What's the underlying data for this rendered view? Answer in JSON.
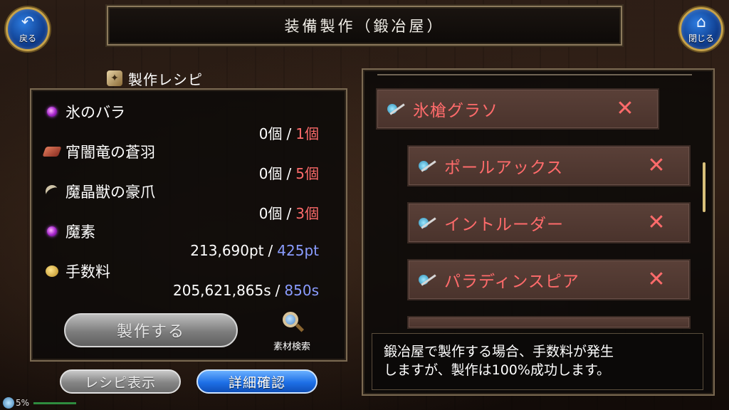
{
  "header": {
    "title": "装備製作（鍛冶屋）",
    "back_label": "戻る",
    "close_label": "閉じる"
  },
  "recipe": {
    "title": "製作レシピ",
    "materials": [
      {
        "icon": "purple-orb-icon",
        "name": "氷のバラ",
        "owned": "0個",
        "required": "1個"
      },
      {
        "icon": "dragon-feather-icon",
        "name": "宵闇竜の蒼羽",
        "owned": "0個",
        "required": "5個"
      },
      {
        "icon": "beast-claw-icon",
        "name": "魔晶獣の豪爪",
        "owned": "0個",
        "required": "3個"
      },
      {
        "icon": "purple-orb-icon",
        "name": "魔素",
        "owned": "213,690pt",
        "required": "425pt"
      },
      {
        "icon": "coin-icon",
        "name": "手数料",
        "owned": "205,621,865s",
        "required": "850s"
      }
    ],
    "separator": "/",
    "craft_button": "製作する",
    "search_button": "素材検索",
    "recipe_view_button": "レシピ表示",
    "detail_button": "詳細確認"
  },
  "items": {
    "main": {
      "name": "氷槍グラソ",
      "icon": "spear-icon"
    },
    "subs": [
      {
        "name": "ポールアックス",
        "icon": "spear-icon"
      },
      {
        "name": "イントルーダー",
        "icon": "spear-icon"
      },
      {
        "name": "パラディンスピア",
        "icon": "spear-icon"
      }
    ],
    "remove_glyph": "✕"
  },
  "description": {
    "line1": "鍛冶屋で製作する場合、手数料が発生",
    "line2": "しますが、製作は100%成功します。"
  },
  "status": {
    "percent": "5%"
  },
  "colors": {
    "required_red": "#ff6b6b",
    "required_blue": "#8a9cff",
    "blue_button": "#1d6fe6",
    "gold_border": "#c6a24a"
  }
}
